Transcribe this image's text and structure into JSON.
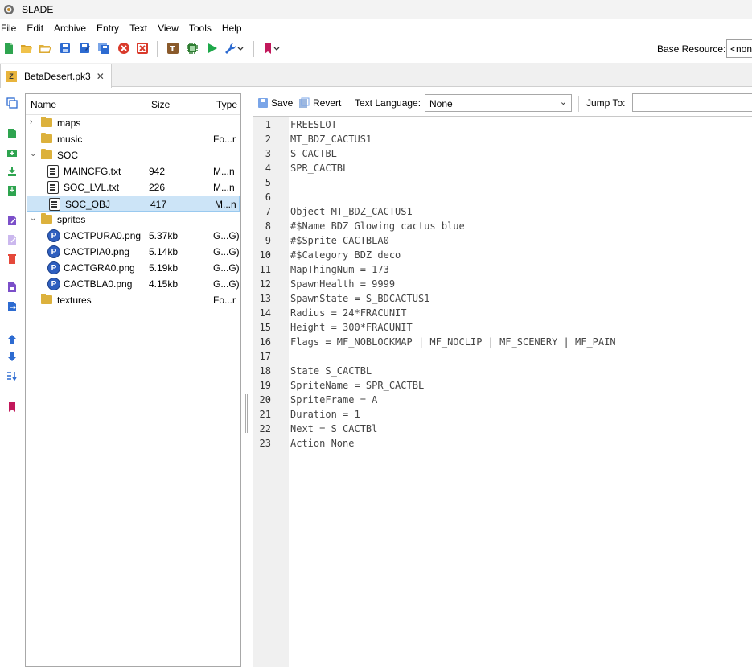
{
  "window": {
    "title": "SLADE"
  },
  "menu": [
    "File",
    "Edit",
    "Archive",
    "Entry",
    "Text",
    "View",
    "Tools",
    "Help"
  ],
  "toolbar": {
    "icons": [
      "new-archive-icon",
      "open-archive-icon",
      "open-dir-icon",
      "save-icon",
      "save-as-icon",
      "save-all-icon",
      "close-icon",
      "close-all-icon",
      "script-icon",
      "map-editor-icon",
      "run-icon",
      "wrench-icon",
      "bookmark-icon"
    ],
    "base_resource_label": "Base Resource:",
    "base_resource_value": "<none>"
  },
  "tab": {
    "label": "BetaDesert.pk3",
    "close": "✕",
    "icon_letter": "Z"
  },
  "tree": {
    "columns": [
      "Name",
      "Size",
      "Type"
    ],
    "rows": [
      {
        "name": "maps",
        "size": "",
        "type": "",
        "kind": "folder",
        "arrow": "›",
        "indent": 0
      },
      {
        "name": "music",
        "size": "",
        "type": "Fo...r",
        "kind": "folder",
        "arrow": "",
        "indent": 0
      },
      {
        "name": "SOC",
        "size": "",
        "type": "",
        "kind": "folder",
        "arrow": "⌄",
        "indent": 0
      },
      {
        "name": "MAINCFG.txt",
        "size": "942",
        "type": "M...n",
        "kind": "text",
        "arrow": "",
        "indent": 1
      },
      {
        "name": "SOC_LVL.txt",
        "size": "226",
        "type": "M...n",
        "kind": "text",
        "arrow": "",
        "indent": 1
      },
      {
        "name": "SOC_OBJ",
        "size": "417",
        "type": "M...n",
        "kind": "text",
        "arrow": "",
        "indent": 1,
        "selected": true
      },
      {
        "name": "sprites",
        "size": "",
        "type": "",
        "kind": "folder",
        "arrow": "⌄",
        "indent": 0
      },
      {
        "name": "CACTPURA0.png",
        "size": "5.37kb",
        "type": "G...G)",
        "kind": "png",
        "arrow": "",
        "indent": 1
      },
      {
        "name": "CACTPIA0.png",
        "size": "5.14kb",
        "type": "G...G)",
        "kind": "png",
        "arrow": "",
        "indent": 1
      },
      {
        "name": "CACTGRA0.png",
        "size": "5.19kb",
        "type": "G...G)",
        "kind": "png",
        "arrow": "",
        "indent": 1
      },
      {
        "name": "CACTBLA0.png",
        "size": "4.15kb",
        "type": "G...G)",
        "kind": "png",
        "arrow": "",
        "indent": 1
      },
      {
        "name": "textures",
        "size": "",
        "type": "Fo...r",
        "kind": "folder",
        "arrow": "",
        "indent": 0
      }
    ]
  },
  "editor": {
    "save_label": "Save",
    "revert_label": "Revert",
    "language_label": "Text Language:",
    "language_value": "None",
    "jump_label": "Jump To:",
    "lines": [
      "FREESLOT",
      "MT_BDZ_CACTUS1",
      "S_CACTBL",
      "SPR_CACTBL",
      "",
      "",
      "Object MT_BDZ_CACTUS1",
      "#$Name BDZ Glowing cactus blue",
      "#$Sprite CACTBLA0",
      "#$Category BDZ deco",
      "MapThingNum = 173",
      "SpawnHealth = 9999",
      "SpawnState = S_BDCACTUS1",
      "Radius = 24*FRACUNIT",
      "Height = 300*FRACUNIT",
      "Flags = MF_NOBLOCKMAP | MF_NOCLIP | MF_SCENERY | MF_PAIN",
      "",
      "State S_CACTBL",
      "SpriteName = SPR_CACTBL",
      "SpriteFrame = A",
      "Duration = 1",
      "Next = S_CACTBl",
      "Action None"
    ]
  },
  "colors": {
    "selection": "#cce4f7",
    "folder": "#dcb13c",
    "png_badge": "#2f5fbf",
    "gutter": "#f0f0f0"
  }
}
